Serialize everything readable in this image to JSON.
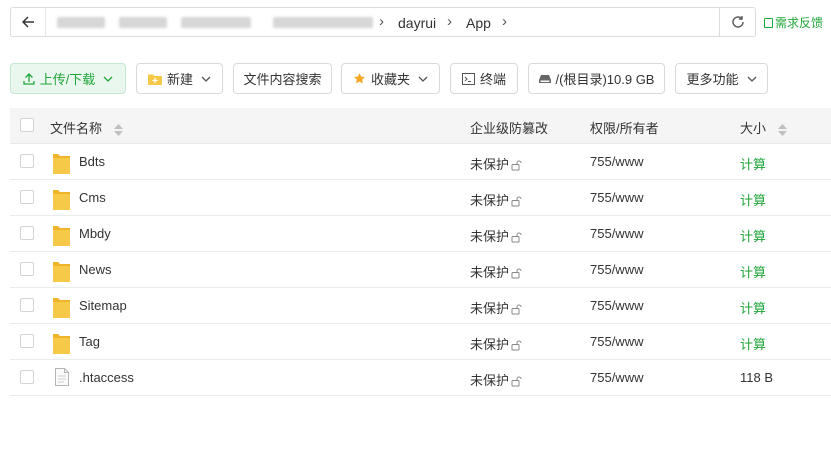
{
  "pathbar": {
    "breadcrumbs": [
      "dayrui",
      "App"
    ]
  },
  "feedback_label": "需求反馈",
  "toolbar": {
    "upload_label": "上传/下载",
    "new_label": "新建",
    "search_label": "文件内容搜索",
    "favorites_label": "收藏夹",
    "terminal_label": "终端",
    "disk_label": "/(根目录)10.9 GB",
    "more_label": "更多功能"
  },
  "table": {
    "headers": {
      "name": "文件名称",
      "protection": "企业级防篡改",
      "permission": "权限/所有者",
      "size": "大小"
    },
    "rows": [
      {
        "name": "Bdts",
        "type": "folder",
        "protection": "未保护",
        "permission": "755/www",
        "size": "计算"
      },
      {
        "name": "Cms",
        "type": "folder",
        "protection": "未保护",
        "permission": "755/www",
        "size": "计算"
      },
      {
        "name": "Mbdy",
        "type": "folder",
        "protection": "未保护",
        "permission": "755/www",
        "size": "计算"
      },
      {
        "name": "News",
        "type": "folder",
        "protection": "未保护",
        "permission": "755/www",
        "size": "计算"
      },
      {
        "name": "Sitemap",
        "type": "folder",
        "protection": "未保护",
        "permission": "755/www",
        "size": "计算"
      },
      {
        "name": "Tag",
        "type": "folder",
        "protection": "未保护",
        "permission": "755/www",
        "size": "计算"
      },
      {
        "name": ".htaccess",
        "type": "file",
        "protection": "未保护",
        "permission": "755/www",
        "size": "118 B"
      }
    ]
  },
  "colors": {
    "accent": "#20a53a",
    "folder": "#f7c948",
    "header_bg": "#f5f5f5"
  }
}
